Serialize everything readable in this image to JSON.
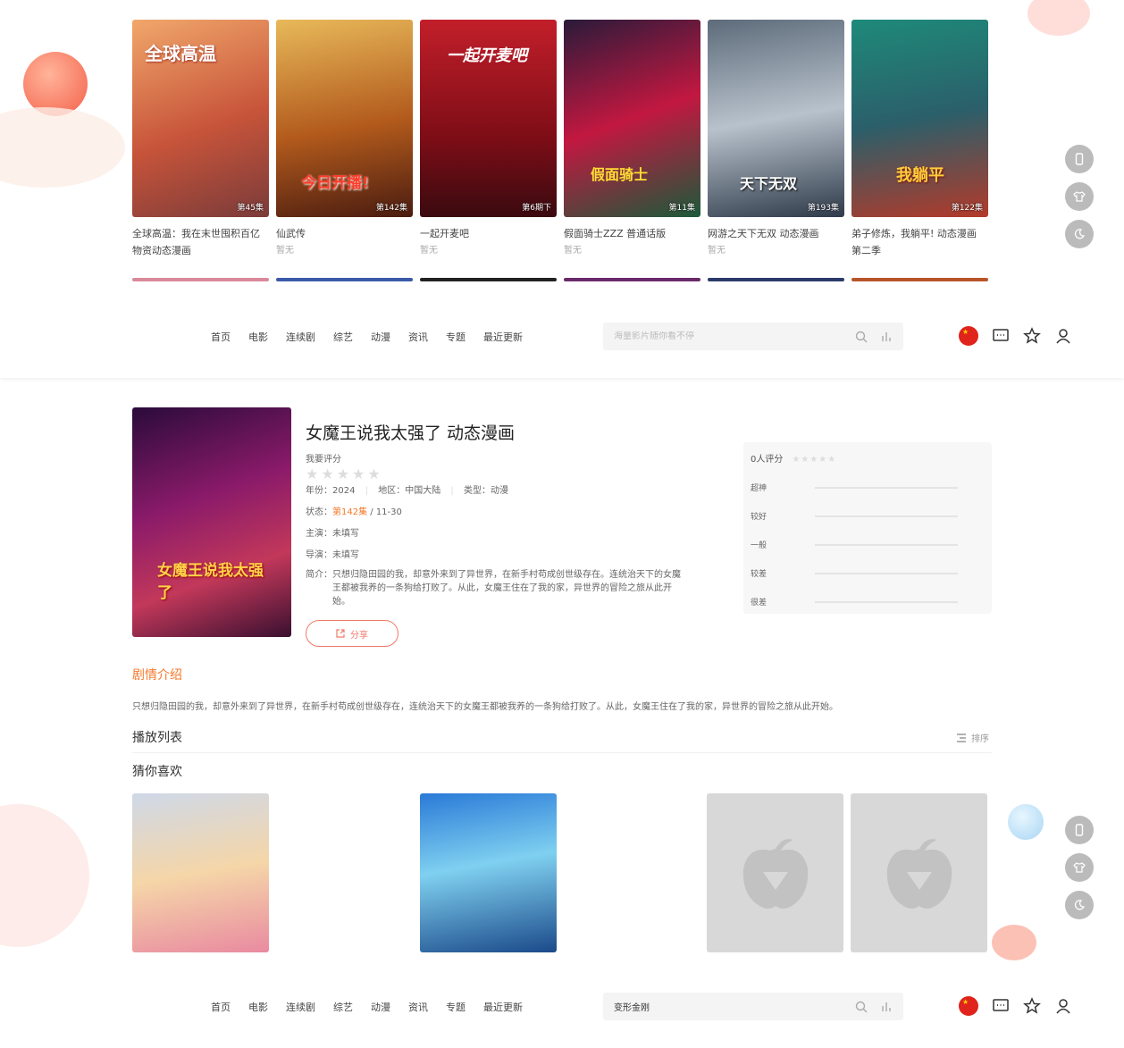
{
  "top_cards": [
    {
      "title": "全球高温：我在末世囤积百亿物资动态漫画",
      "subtitle": "",
      "episode": "第45集",
      "poster_text": "全球高温"
    },
    {
      "title": "仙武传",
      "subtitle": "暂无",
      "episode": "第142集",
      "poster_text": "今日开播!"
    },
    {
      "title": "一起开麦吧",
      "subtitle": "暂无",
      "episode": "第6期下",
      "poster_text": "一起开麦吧"
    },
    {
      "title": "假面骑士ZZZ 普通话版",
      "subtitle": "暂无",
      "episode": "第11集",
      "poster_text": "假面骑士"
    },
    {
      "title": "网游之天下无双 动态漫画",
      "subtitle": "暂无",
      "episode": "第193集",
      "poster_text": "天下无双"
    },
    {
      "title": "弟子修炼，我躺平! 动态漫画 第二季",
      "subtitle": "",
      "episode": "第122集",
      "poster_text": "我躺平"
    }
  ],
  "nav": [
    "首页",
    "电影",
    "连续剧",
    "综艺",
    "动漫",
    "资讯",
    "专题",
    "最近更新"
  ],
  "search": {
    "placeholder": "海量影片随你看不停",
    "value_second": "变形金刚"
  },
  "detail": {
    "title": "女魔王说我太强了 动态漫画",
    "rate_label": "我要评分",
    "year_label": "年份：",
    "year": "2024",
    "region_label": "地区：",
    "region": "中国大陆",
    "type_label": "类型：",
    "type": "动漫",
    "status_label": "状态：",
    "status_ep": "第142集",
    "status_date": " / 11-30",
    "actor_label": "主演：",
    "actor": "未填写",
    "director_label": "导演：",
    "director": "未填写",
    "intro_label": "简介：",
    "intro": "只想归隐田园的我，却意外来到了异世界，在新手村苟成创世级存在。连统治天下的女魔王都被我养的一条狗给打败了。从此，女魔王住在了我的家，异世界的冒险之旅从此开始。",
    "share": "分享",
    "poster_text": "女魔王说我太强了"
  },
  "rating": {
    "count_label": "0人评分",
    "levels": [
      "超神",
      "较好",
      "一般",
      "较差",
      "很差"
    ]
  },
  "sections": {
    "plot_title": "剧情介绍",
    "plot_text": "只想归隐田园的我，却意外来到了异世界，在新手村苟成创世级存在，连统治天下的女魔王都被我养的一条狗给打败了。从此，女魔王住在了我的家，异世界的冒险之旅从此开始。",
    "playlist_title": "播放列表",
    "sort_label": "排序",
    "guess_title": "猜你喜欢"
  },
  "colors": {
    "accent": "#f47a2c",
    "share": "#f07a6a",
    "side_btn": "#bbbbbb"
  }
}
